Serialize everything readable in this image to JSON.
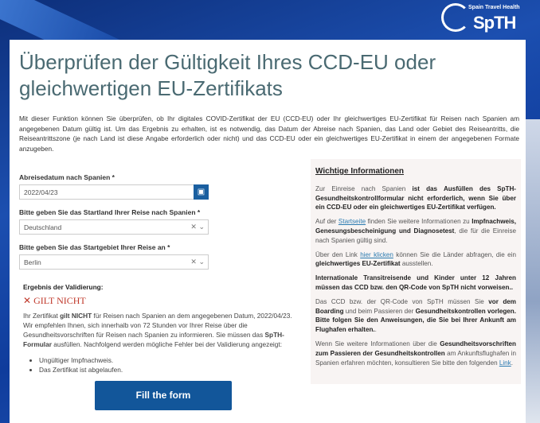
{
  "logo": {
    "brand_top": "Spain Travel Health",
    "brand": "SpTH"
  },
  "title": "Überprüfen der Gültigkeit Ihres CCD-EU oder gleichwertigen EU-Zertifikats",
  "intro": "Mit dieser Funktion können Sie überprüfen, ob Ihr digitales COVID-Zertifikat der EU (CCD-EU) oder Ihr gleichwertiges EU-Zertifikat für Reisen nach Spanien am angegebenen Datum gültig ist. Um das Ergebnis zu erhalten, ist es notwendig, das Datum der Abreise nach Spanien, das Land oder Gebiet des Reiseantritts, die Reiseantrittszone (je nach Land ist diese Angabe erforderlich oder nicht) und das CCD-EU oder ein gleichwertiges EU-Zertifikat in einem der angegebenen Formate anzugeben.",
  "form": {
    "date_label": "Abreisedatum nach Spanien *",
    "date_value": "2022/04/23",
    "country_label": "Bitte geben Sie das Startland Ihrer Reise nach Spanien *",
    "country_value": "Deutschland",
    "region_label": "Bitte geben Sie das Startgebiet Ihrer Reise an *",
    "region_value": "Berlin"
  },
  "result": {
    "heading": "Ergebnis der Validierung:",
    "status": "GILT NICHT",
    "t1": "Ihr Zertifikat ",
    "b1": "gilt NICHT",
    "t2": " für Reisen nach Spanien an dem angegebenen Datum, 2022/04/23. Wir empfehlen Ihnen, sich innerhalb von 72 Stunden vor Ihrer Reise über die Gesundheitsvorschriften für Reisen nach Spanien zu informieren. Sie müssen das ",
    "b2": "SpTH-Formular",
    "t3": " ausfüllen. Nachfolgend werden mögliche Fehler bei der Validierung angezeigt:",
    "errors": [
      "Ungültiger Impfnachweis.",
      "Das Zertifikat ist abgelaufen."
    ]
  },
  "button": "Fill the form",
  "info": {
    "heading": "Wichtige Informationen",
    "p1a": "Zur Einreise nach Spanien ",
    "p1b": "ist das Ausfüllen des SpTH-Gesundheitskontrollformular nicht erforderlich, wenn Sie über ein CCD-EU oder ein gleichwertiges EU-Zertifikat verfügen.",
    "p2a": "Auf der ",
    "p2link": "Startseite",
    "p2b": " finden Sie weitere Informationen zu ",
    "p2c": "Impfnachweis, Genesungsbescheinigung und Diagnosetest",
    "p2d": ", die für die Einreise nach Spanien gültig sind.",
    "p3a": "Über den Link ",
    "p3link": "hier klicken",
    "p3b": " können Sie die Länder abfragen, die ein ",
    "p3c": "gleichwertiges EU-Zertifikat",
    "p3d": " ausstellen.",
    "p4": "Internationale Transitreisende und Kinder unter 12 Jahren müssen das CCD bzw. den QR-Code von SpTH nicht vorweisen..",
    "p5a": "Das CCD bzw. der QR-Code von SpTH müssen Sie ",
    "p5b": "vor dem Boarding",
    "p5c": " und beim Passieren der ",
    "p5d": "Gesundheitskontrollen vorlegen. Bitte folgen Sie den Anweisungen, die Sie bei Ihrer Ankunft am Flughafen erhalten.",
    ".": ".",
    "p6a": "Wenn Sie weitere Informationen über die ",
    "p6b": "Gesundheitsvorschriften zum Passieren der Gesundheitskontrollen",
    "p6c": " am Ankunftsflughafen in Spanien erfahren möchten, konsultieren Sie bitte den folgenden ",
    "p6link": "Link",
    "p6d": "."
  }
}
